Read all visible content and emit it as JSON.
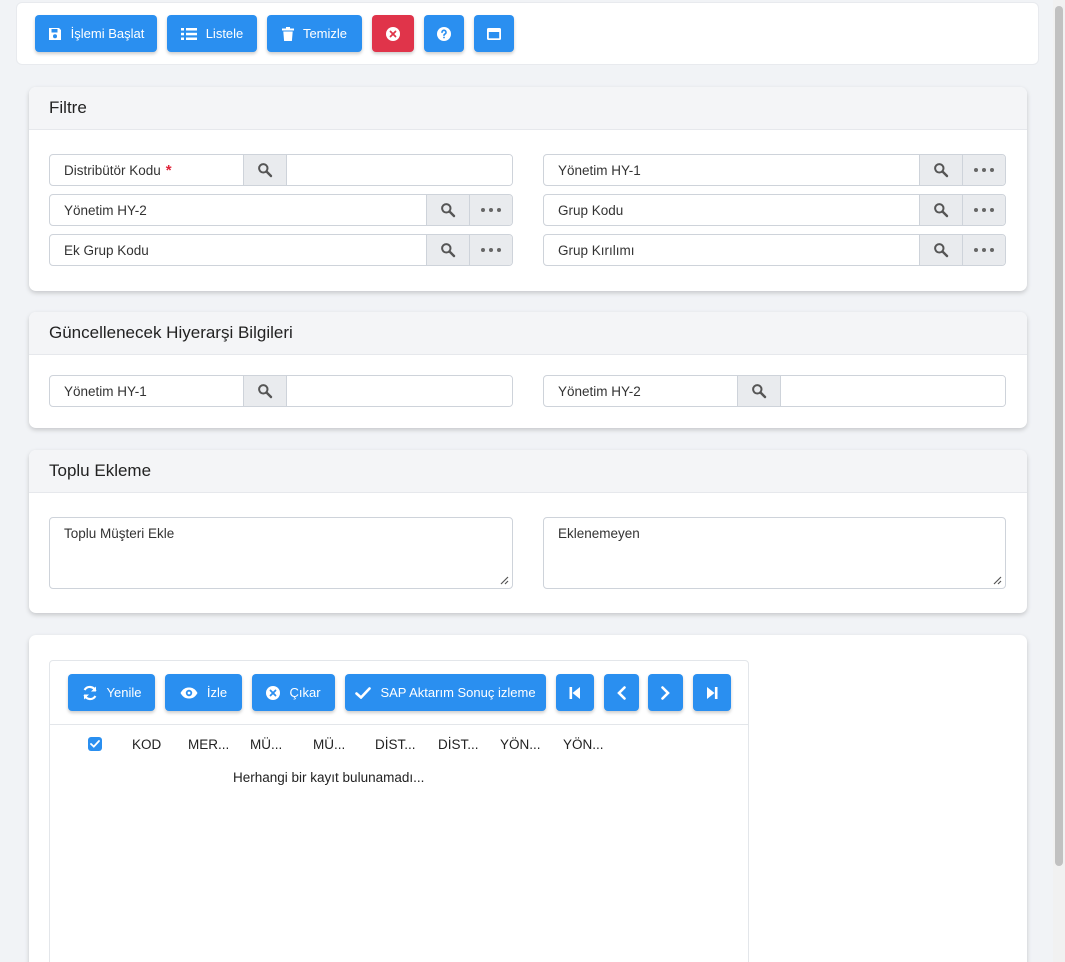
{
  "toolbar": {
    "start_label": "İşlemi Başlat",
    "list_label": "Listele",
    "clear_label": "Temizle"
  },
  "filter": {
    "title": "Filtre",
    "distributor_code": "Distribütör Kodu",
    "required_mark": "*",
    "hy1": "Yönetim HY-1",
    "hy2": "Yönetim HY-2",
    "group_code": "Grup Kodu",
    "extra_group_code": "Ek Grup Kodu",
    "group_break": "Grup Kırılımı"
  },
  "hierarchy": {
    "title": "Güncellenecek Hiyerarşi Bilgileri",
    "hy1": "Yönetim HY-1",
    "hy2": "Yönetim HY-2"
  },
  "bulk": {
    "title": "Toplu Ekleme",
    "add_customers": "Toplu Müşteri Ekle",
    "not_added": "Eklenemeyen"
  },
  "grid": {
    "refresh_label": "Yenile",
    "watch_label": "İzle",
    "remove_label": "Çıkar",
    "sap_label": "SAP Aktarım Sonuç izleme",
    "columns": [
      "KOD",
      "MER...",
      "MÜ...",
      "MÜ...",
      "DİST...",
      "DİST...",
      "YÖN...",
      "YÖN..."
    ],
    "empty_message": "Herhangi bir kayıt bulunamadı..."
  },
  "colors": {
    "primary": "#2a8ff0",
    "danger": "#e0344a"
  }
}
